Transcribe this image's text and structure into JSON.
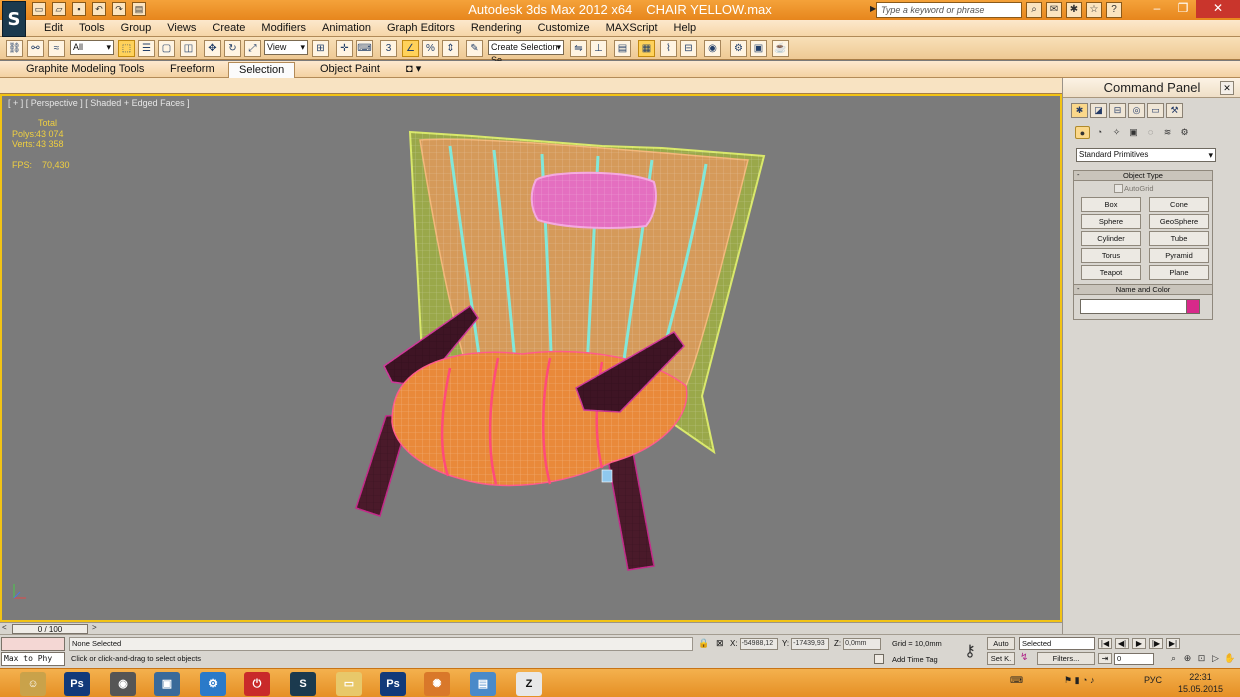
{
  "window": {
    "app_title": "Autodesk 3ds Max  2012 x64",
    "file_name": "CHAIR YELLOW.max",
    "search_placeholder": "Type a keyword or phrase"
  },
  "menu": [
    "Edit",
    "Tools",
    "Group",
    "Views",
    "Create",
    "Modifiers",
    "Animation",
    "Graph Editors",
    "Rendering",
    "Customize",
    "MAXScript",
    "Help"
  ],
  "toolbar": {
    "selection_filter": "All",
    "ref_coord": "View",
    "snap_label": "3",
    "named_selection_placeholder": "Create Selection Se"
  },
  "ribbon": {
    "tabs": [
      "Graphite Modeling Tools",
      "Freeform",
      "Selection",
      "Object Paint"
    ],
    "active_tab": "Selection"
  },
  "viewport": {
    "label": "[ + ] [ Perspective ] [ Shaded + Edged Faces ]",
    "stats": {
      "total_label": "Total",
      "polys_label": "Polys:",
      "polys_value": "43 074",
      "verts_label": "Verts:",
      "verts_value": "43 358",
      "fps_label": "FPS:",
      "fps_value": "70,430"
    }
  },
  "command_panel": {
    "title": "Command Panel",
    "category": "Standard Primitives",
    "object_type_title": "Object Type",
    "autogrid_label": "AutoGrid",
    "object_buttons": [
      "Box",
      "Cone",
      "Sphere",
      "GeoSphere",
      "Cylinder",
      "Tube",
      "Torus",
      "Pyramid",
      "Teapot",
      "Plane"
    ],
    "name_color_title": "Name and Color",
    "name_value": "",
    "color": "#d8298a"
  },
  "timeline": {
    "frame_display": "0 / 100"
  },
  "statusbar": {
    "maxscript_listener": "",
    "maxscript_input": "Max to Phy",
    "selection_status": "None Selected",
    "prompt": "Click or click-and-drag to select objects",
    "x_label": "X:",
    "x_value": "-54988,12",
    "y_label": "Y:",
    "y_value": "-17439,93",
    "z_label": "Z:",
    "z_value": "0,0mm",
    "grid": "Grid = 10,0mm",
    "add_time_tag": "Add Time Tag",
    "auto_key": "Auto",
    "set_key": "Set K.",
    "key_filter": "Selected",
    "filters": "Filters...",
    "frame": "0"
  },
  "taskbar": {
    "items": [
      "Ps",
      "Ps"
    ],
    "tray_lang": "РУС",
    "time": "22:31",
    "date": "15.05.2015"
  },
  "colors": {
    "title_orange": "#e7861d",
    "viewport_bg": "#7b7b7b",
    "viewport_border": "#f2c314",
    "seat_orange": "#e9893a",
    "cushion_pink": "#e46fc0",
    "leg_dark": "#4a1a2a",
    "wire_cyan": "#7af0e6",
    "wire_yellow": "#d9e86a"
  }
}
